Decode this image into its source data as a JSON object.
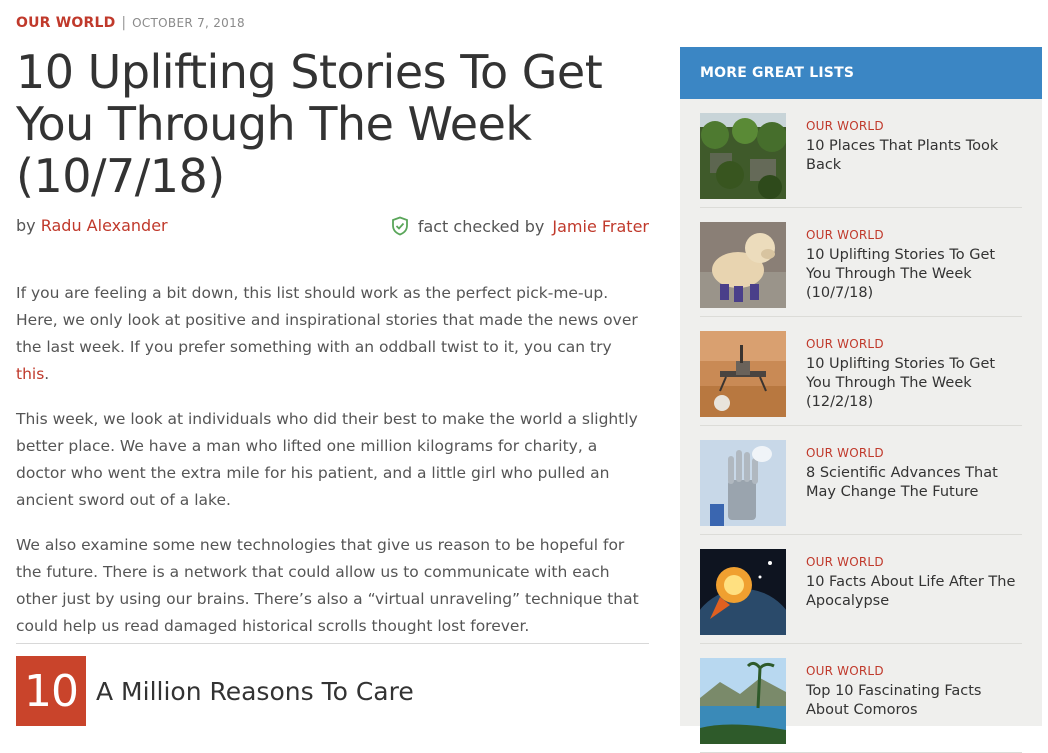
{
  "article": {
    "category": "OUR WORLD",
    "separator": "|",
    "date": "OCTOBER 7, 2018",
    "title": "10 Uplifting Stories To Get You Through The Week (10/7/18)",
    "byline_prefix": "by",
    "author": "Radu Alexander",
    "fact_prefix": "fact checked by",
    "fact_checker": "Jamie Frater",
    "paragraph1_text": "If you are feeling a bit down, this list should work as the perfect pick-me-up. Here, we only look at positive and inspirational stories that made the news over the last week. If you prefer something with an oddball twist to it, you can try",
    "paragraph1_link": "this",
    "paragraph1_end": ".",
    "paragraph2": "This week, we look at individuals who did their best to make the world a slightly better place. We have a man who lifted one million kilograms for charity, a doctor who went the extra mile for his patient, and a little girl who pulled an ancient sword out of a lake.",
    "paragraph3": "We also examine some new technologies that give us reason to be hopeful for the future. There is a network that could allow us to communicate with each other just by using our brains. There’s also a “virtual unraveling” technique that could help us read damaged historical scrolls thought lost forever.",
    "item_number": "10",
    "item_title": "A Million Reasons To Care"
  },
  "sidebar": {
    "header": "MORE GREAT LISTS",
    "items": [
      {
        "category": "OUR WORLD",
        "title": "10 Places That Plants Took Back",
        "thumb": "overgrown-village"
      },
      {
        "category": "OUR WORLD",
        "title": "10 Uplifting Stories To Get You Through The Week (10/7/18)",
        "thumb": "dog-with-boots"
      },
      {
        "category": "OUR WORLD",
        "title": "10 Uplifting Stories To Get You Through The Week (12/2/18)",
        "thumb": "mars-lander"
      },
      {
        "category": "OUR WORLD",
        "title": "8 Scientific Advances That May Change The Future",
        "thumb": "robot-hand"
      },
      {
        "category": "OUR WORLD",
        "title": "10 Facts About Life After The Apocalypse",
        "thumb": "earth-explosion"
      },
      {
        "category": "OUR WORLD",
        "title": "Top 10 Fascinating Facts About Comoros",
        "thumb": "tropical-island"
      }
    ]
  },
  "colors": {
    "accent": "#c0392b",
    "sidebar_header": "#3b86c4",
    "fact_check_icon": "#5aa65a"
  }
}
